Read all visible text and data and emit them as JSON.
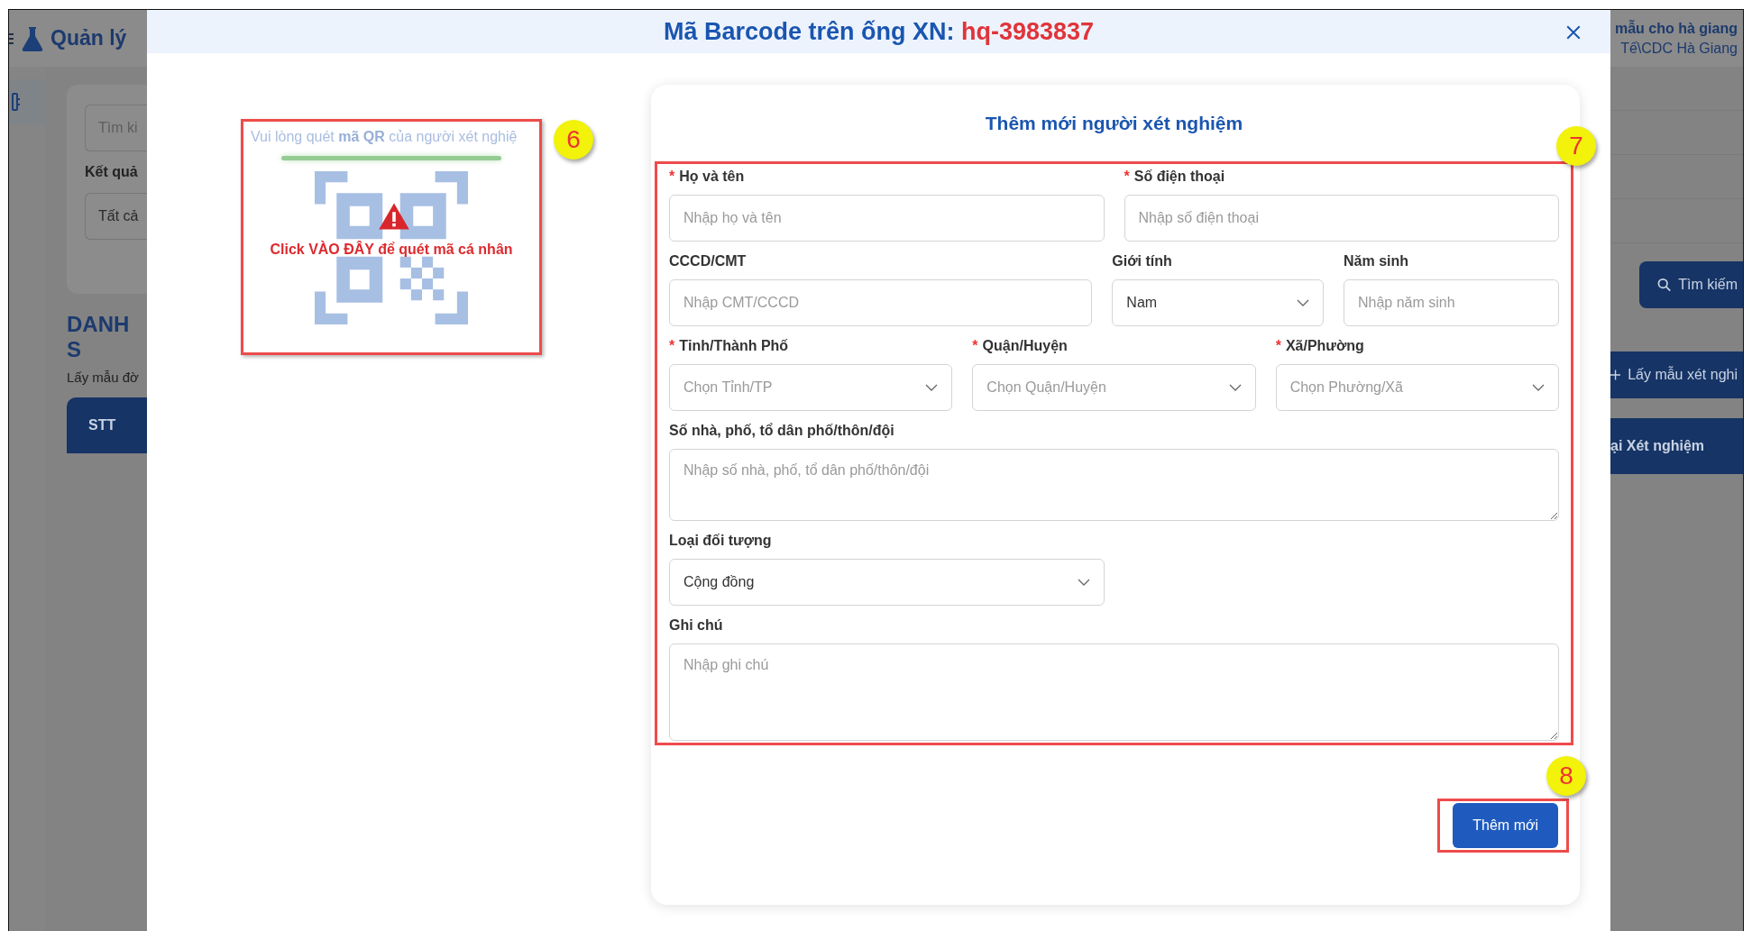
{
  "background": {
    "app_title": "Quản lý",
    "org_name": "mẫu cho hà giang",
    "org_path": "Tế\\CDC Hà Giang",
    "search_placeholder": "Tìm ki",
    "filter_label": "Kết quả",
    "filter_value": "Tất cả",
    "search_button": "Tìm kiếm",
    "list_title": "DANH S",
    "list_subtitle": "Lấy mẫu đờ",
    "add_button": "Lấy mẫu xét nghi",
    "table_columns": [
      "STT",
      "ại Xét nghiệm"
    ]
  },
  "dialog": {
    "title": "Mã Barcode trên ống XN:",
    "barcode": "hq-3983837",
    "scanner": {
      "hint": "Vui lòng quét **mã QR** của người xét nghiệ",
      "action": "Click VÀO ĐÂY để quét mã cá nhân"
    },
    "form": {
      "title": "Thêm mới người xét nghiệm",
      "rows": [
        [
          {
            "kind": "text",
            "label": "Họ và tên",
            "marker": "*",
            "placeholder": "Nhập họ và tên"
          },
          {
            "kind": "text",
            "label": "Số điện thoại",
            "marker": "*",
            "placeholder": "Nhập số điện thoại"
          }
        ],
        [
          {
            "kind": "text",
            "label": "CCCD/CMT",
            "placeholder": "Nhập CMT/CCCD"
          },
          {
            "kind": "select",
            "label": "Giới tính",
            "value": "Nam"
          },
          {
            "kind": "text",
            "label": "Năm sinh",
            "placeholder": "Nhập năm sinh"
          }
        ],
        [
          {
            "kind": "select",
            "label": "Tỉnh/Thành Phố",
            "marker": "*",
            "placeholder": "Chọn Tỉnh/TP"
          },
          {
            "kind": "select",
            "label": "Quận/Huyện",
            "marker": "*",
            "placeholder": "Chọn Quận/Huyện"
          },
          {
            "kind": "select",
            "label": "Xã/Phường",
            "marker": "*",
            "placeholder": "Chọn Phường/Xã"
          }
        ],
        [
          {
            "kind": "textarea",
            "label": "Số nhà, phố, tổ dân phố/thôn/đội",
            "placeholder": "Nhập số nhà, phố, tổ dân phố/thôn/đội"
          }
        ],
        [
          {
            "kind": "select",
            "label": "Loại đối tượng",
            "value": "Cộng đồng"
          }
        ],
        [
          {
            "kind": "textarea",
            "label": "Ghi chú",
            "placeholder": "Nhập ghi chú"
          }
        ]
      ]
    },
    "submit_button": "Thêm mới"
  },
  "annotations": [
    "6",
    "7",
    "8"
  ]
}
